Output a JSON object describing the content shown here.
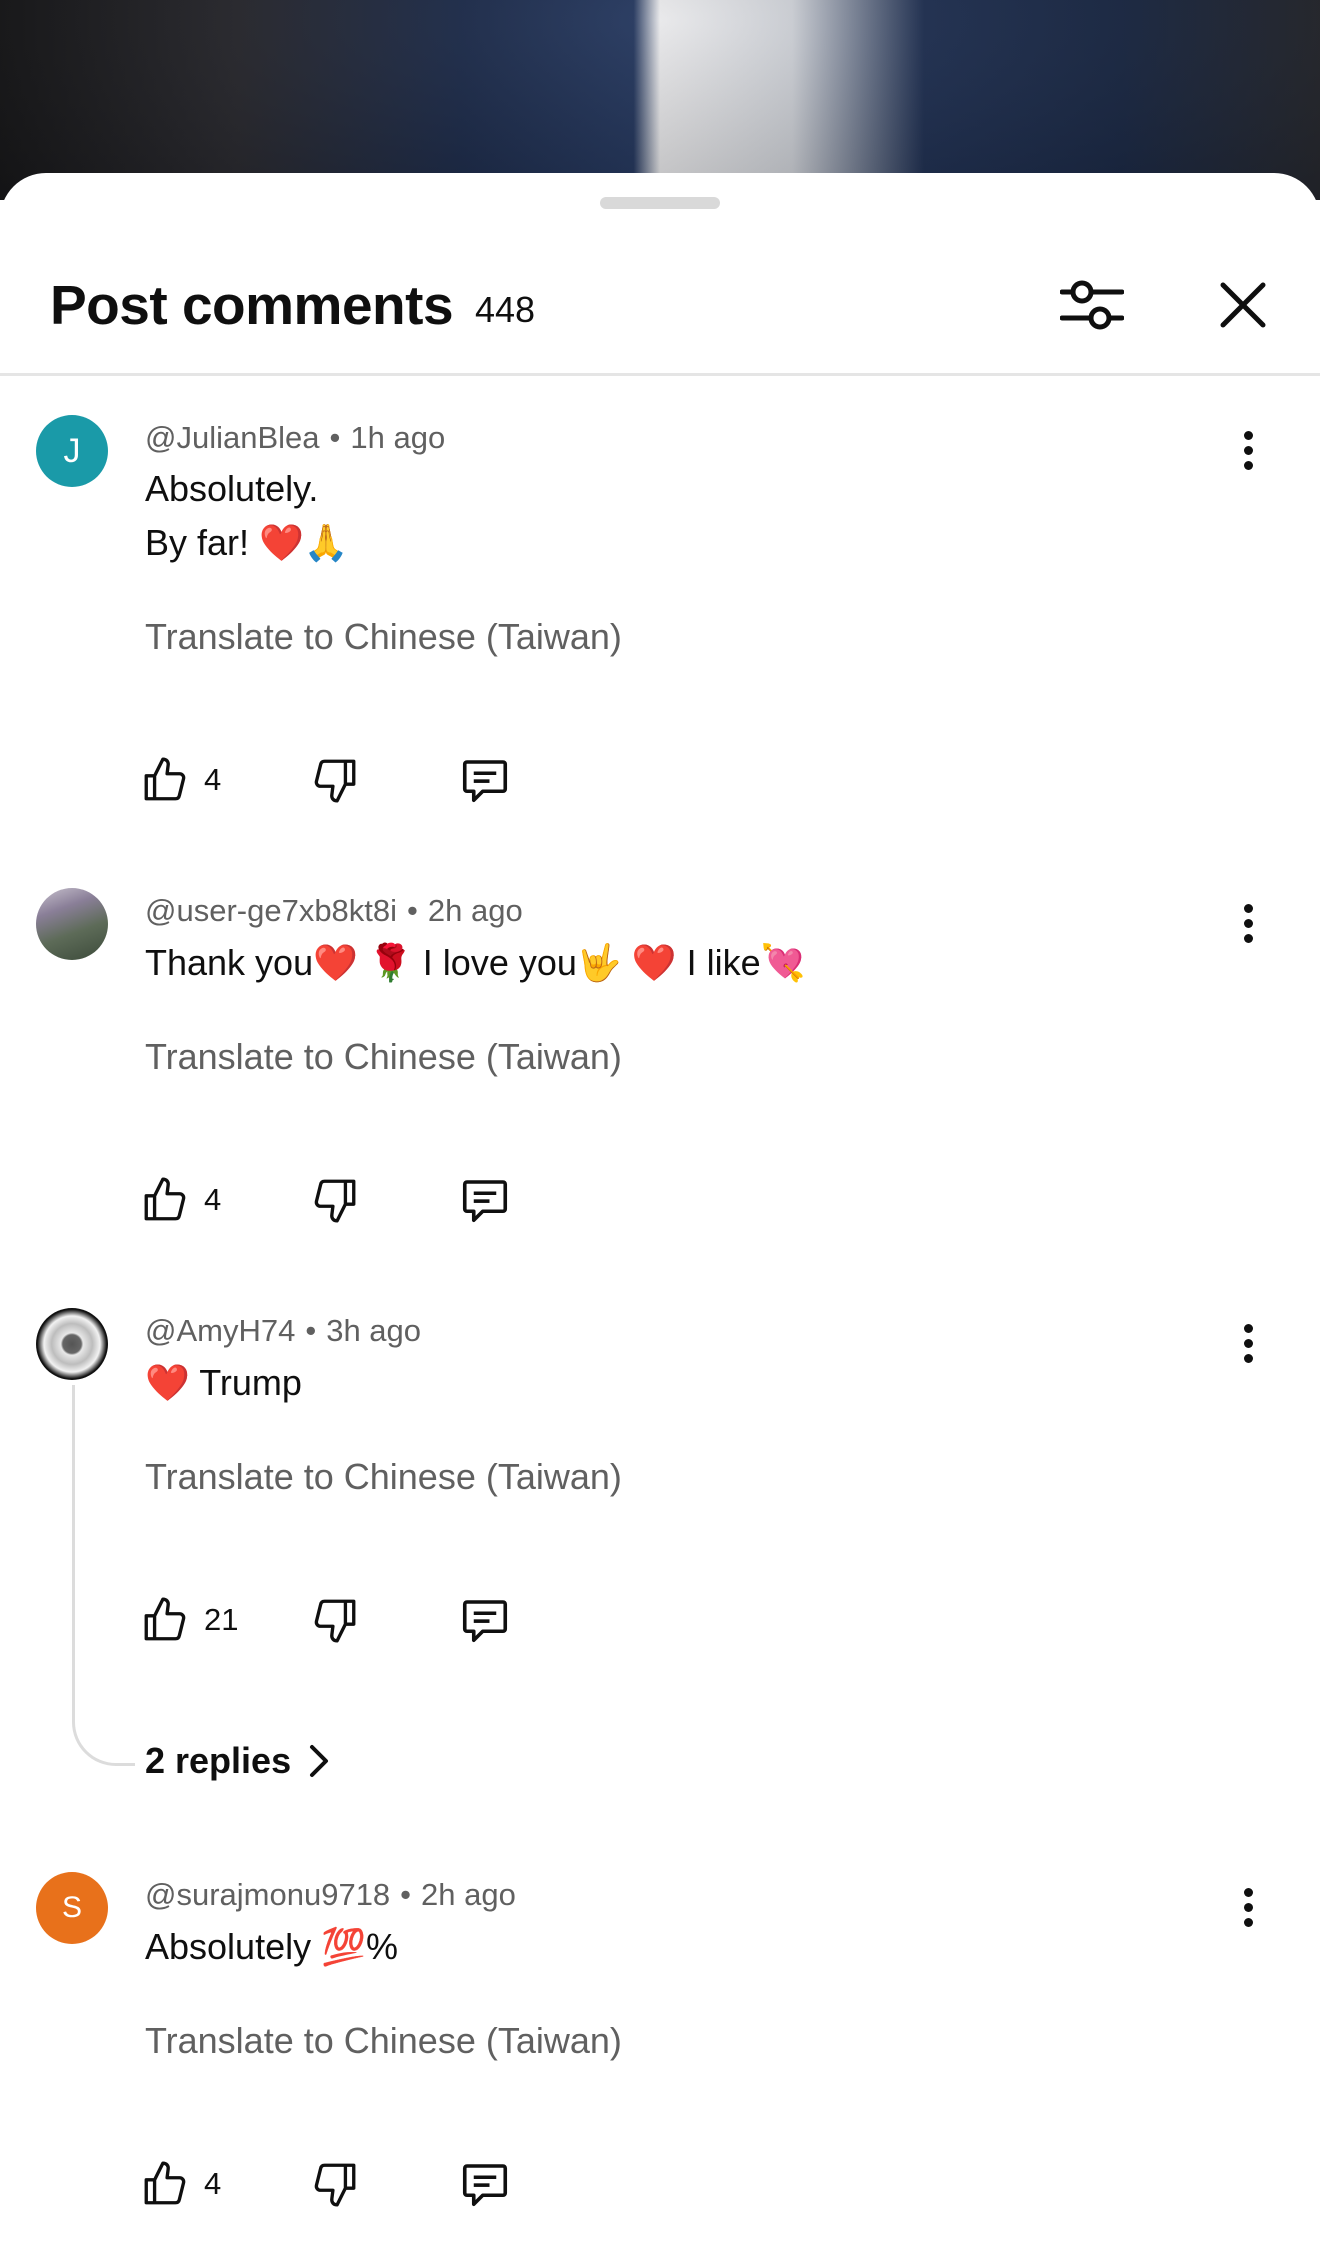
{
  "sheet": {
    "title": "Post comments",
    "count": "448",
    "filter_icon": "sliders-icon",
    "close_icon": "close-icon"
  },
  "comments": [
    {
      "author": "@JulianBlea",
      "time": "1h ago",
      "avatar_letter": "J",
      "avatar_color": "#1a9aa8",
      "lines": [
        "Absolutely.",
        "By far!"
      ],
      "emojis": [
        "❤️",
        "🙏"
      ],
      "translate": "Translate to Chinese (Taiwan)",
      "likes": "4"
    },
    {
      "author": "@user-ge7xb8kt8i",
      "time": "2h ago",
      "avatar_letter": "",
      "avatar_color": "#7d8a7c",
      "text_parts": [
        "Thank you",
        "I love you",
        "I like"
      ],
      "emojis": [
        "❤️",
        "🌹",
        "🤟",
        "❤️",
        "💘"
      ],
      "translate": "Translate to Chinese (Taiwan)",
      "likes": "4"
    },
    {
      "author": "@AmyH74",
      "time": "3h ago",
      "avatar_letter": "",
      "avatar_color": "#222222",
      "text": "Trump",
      "emojis": [
        "❤️"
      ],
      "translate": "Translate to Chinese (Taiwan)",
      "likes": "21",
      "replies": "2 replies"
    },
    {
      "author": "@surajmonu9718",
      "time": "2h ago",
      "avatar_letter": "S",
      "avatar_color": "#e8711b",
      "text": "Absolutely",
      "suffix": "%",
      "emojis": [
        "💯"
      ],
      "translate": "Translate to Chinese (Taiwan)",
      "likes": "4"
    }
  ]
}
